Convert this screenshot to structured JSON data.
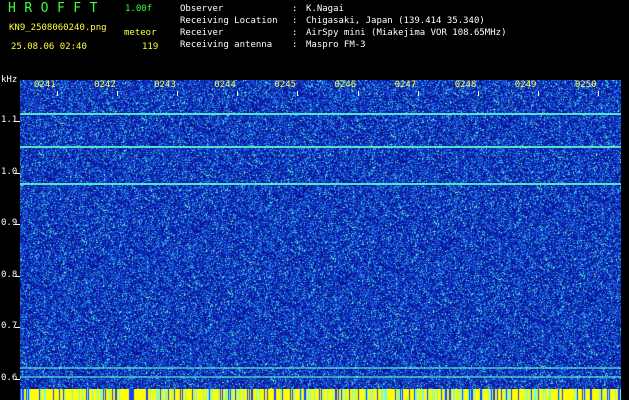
{
  "header": {
    "app_title": "HROFFT",
    "version": "1.00f",
    "filename": "KN9_2508060240.png",
    "mode": "meteor",
    "datetime": "25.08.06 02:40",
    "count": "119"
  },
  "info_rows": [
    {
      "key": "Observer",
      "value": "K.Nagai"
    },
    {
      "key": "Receiving Location",
      "value": "Chigasaki, Japan (139.414 35.340)"
    },
    {
      "key": "Receiver",
      "value": "AirSpy mini (Miakejima VOR 108.65MHz)"
    },
    {
      "key": "Receiving antenna",
      "value": "Maspro FM-3"
    }
  ],
  "y_axis": {
    "unit": "kHz",
    "labels": [
      "1.1",
      "1.0",
      "0.9",
      "0.8",
      "0.7",
      "0.6"
    ],
    "range": [
      0.58,
      1.18
    ]
  },
  "x_axis": {
    "labels": [
      "0241",
      "0242",
      "0243",
      "0244",
      "0245",
      "0246",
      "0247",
      "0248",
      "0249",
      "0250"
    ]
  },
  "signal_lines_khz": [
    1.114,
    1.05,
    0.978,
    0.62,
    0.603
  ],
  "colors": {
    "background": "#0a1ea6",
    "title": "#3cff3c",
    "meta": "#ffff3c",
    "signal": "#5cffd0",
    "baseline": "#ffff00"
  }
}
